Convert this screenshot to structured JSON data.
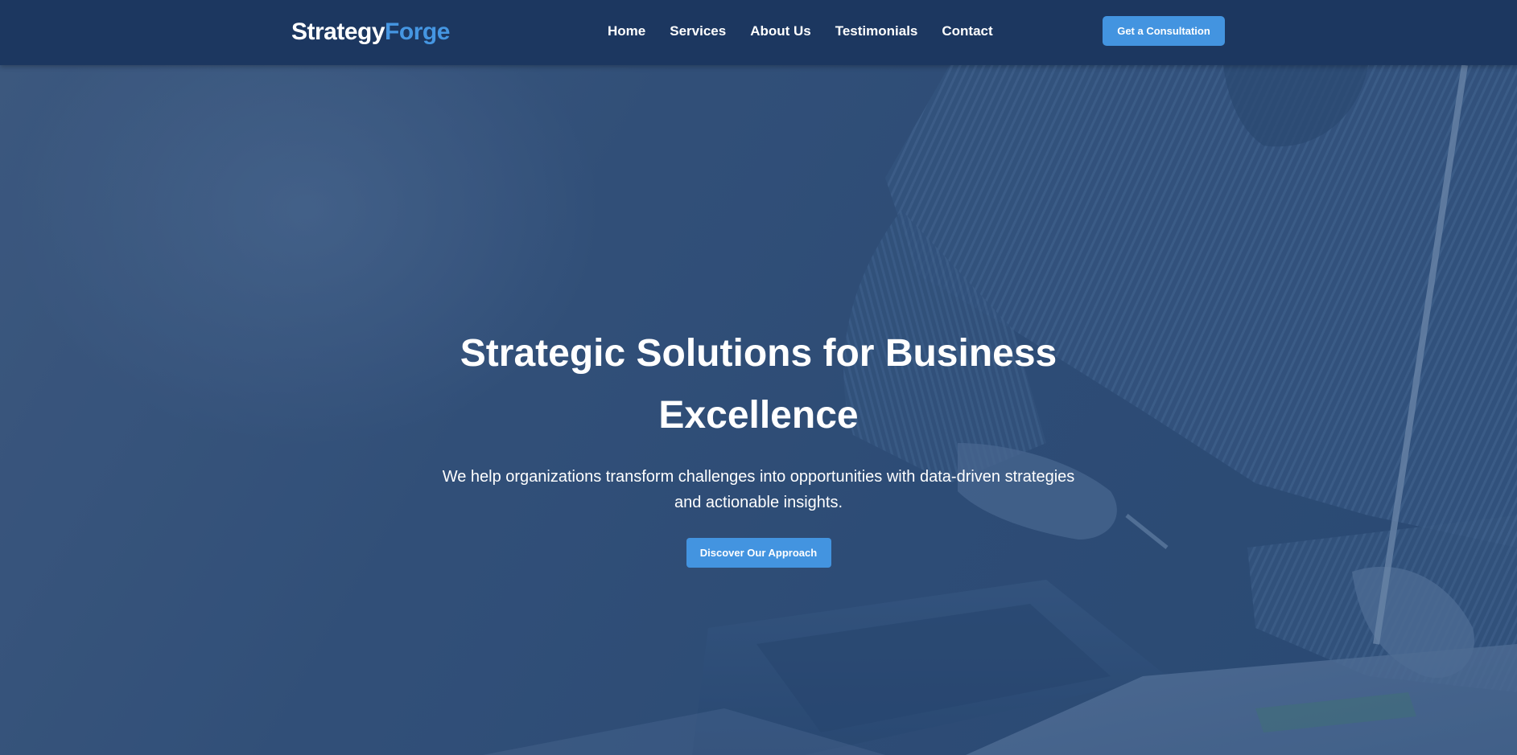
{
  "header": {
    "logo_primary": "Strategy",
    "logo_accent": "Forge",
    "nav": [
      {
        "label": "Home"
      },
      {
        "label": "Services"
      },
      {
        "label": "About Us"
      },
      {
        "label": "Testimonials"
      },
      {
        "label": "Contact"
      }
    ],
    "cta_label": "Get a Consultation"
  },
  "hero": {
    "title": "Strategic Solutions for Business Excellence",
    "subtitle": "We help organizations transform challenges into opportunities with data-driven strategies and actionable insights.",
    "cta_label": "Discover Our Approach",
    "background_image": "businessman-writing-at-desk-with-laptop-photo"
  },
  "colors": {
    "header_bg": "#1c3760",
    "accent": "#4394e0",
    "logo_accent": "#4596e2",
    "hero_overlay": "#2c4a72",
    "text": "#ffffff"
  }
}
